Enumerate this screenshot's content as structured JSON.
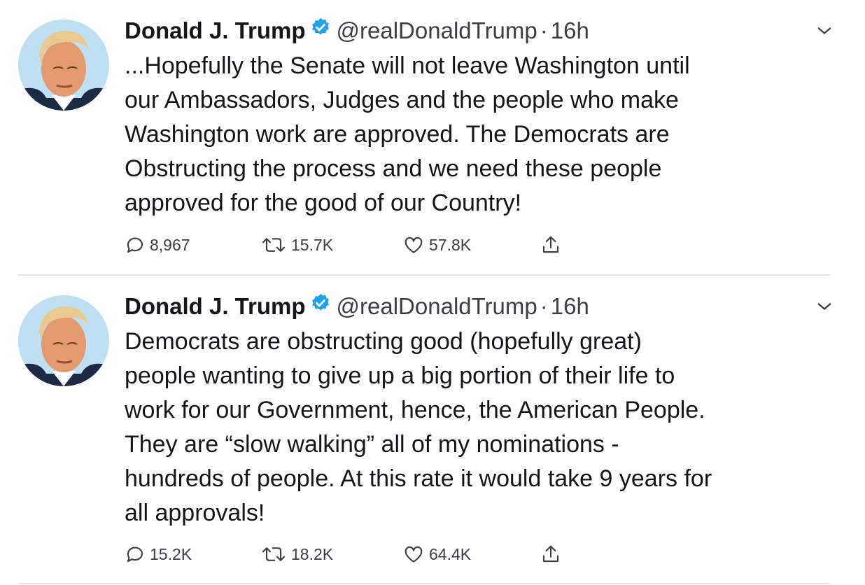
{
  "colors": {
    "text": "#14171a",
    "secondary": "#3a3f44",
    "verified": "#1da1f2",
    "divider": "#e3e6e8"
  },
  "tweets": [
    {
      "name": "Donald J. Trump",
      "handle": "@realDonaldTrump",
      "separator": "·",
      "time": "16h",
      "text": "...Hopefully the Senate will not leave Washington until\nour Ambassadors, Judges and the people who make\nWashington work are approved. The Democrats are\nObstructing the process and we need these people\napproved for the good of our Country!",
      "replies": "8,967",
      "retweets": "15.7K",
      "likes": "57.8K"
    },
    {
      "name": "Donald J. Trump",
      "handle": "@realDonaldTrump",
      "separator": "·",
      "time": "16h",
      "text": "Democrats are obstructing good (hopefully great)\npeople wanting to give up a big portion of their life to\nwork for our Government, hence, the American People.\nThey are “slow walking” all of my nominations -\nhundreds of people. At this rate it would take 9 years for\nall approvals!",
      "replies": "15.2K",
      "retweets": "18.2K",
      "likes": "64.4K"
    }
  ],
  "icons": {
    "verified": "verified-badge-icon",
    "more": "chevron-down-icon",
    "reply": "speech-bubble-icon",
    "retweet": "retweet-arrows-icon",
    "like": "heart-icon",
    "share": "share-upload-icon"
  }
}
